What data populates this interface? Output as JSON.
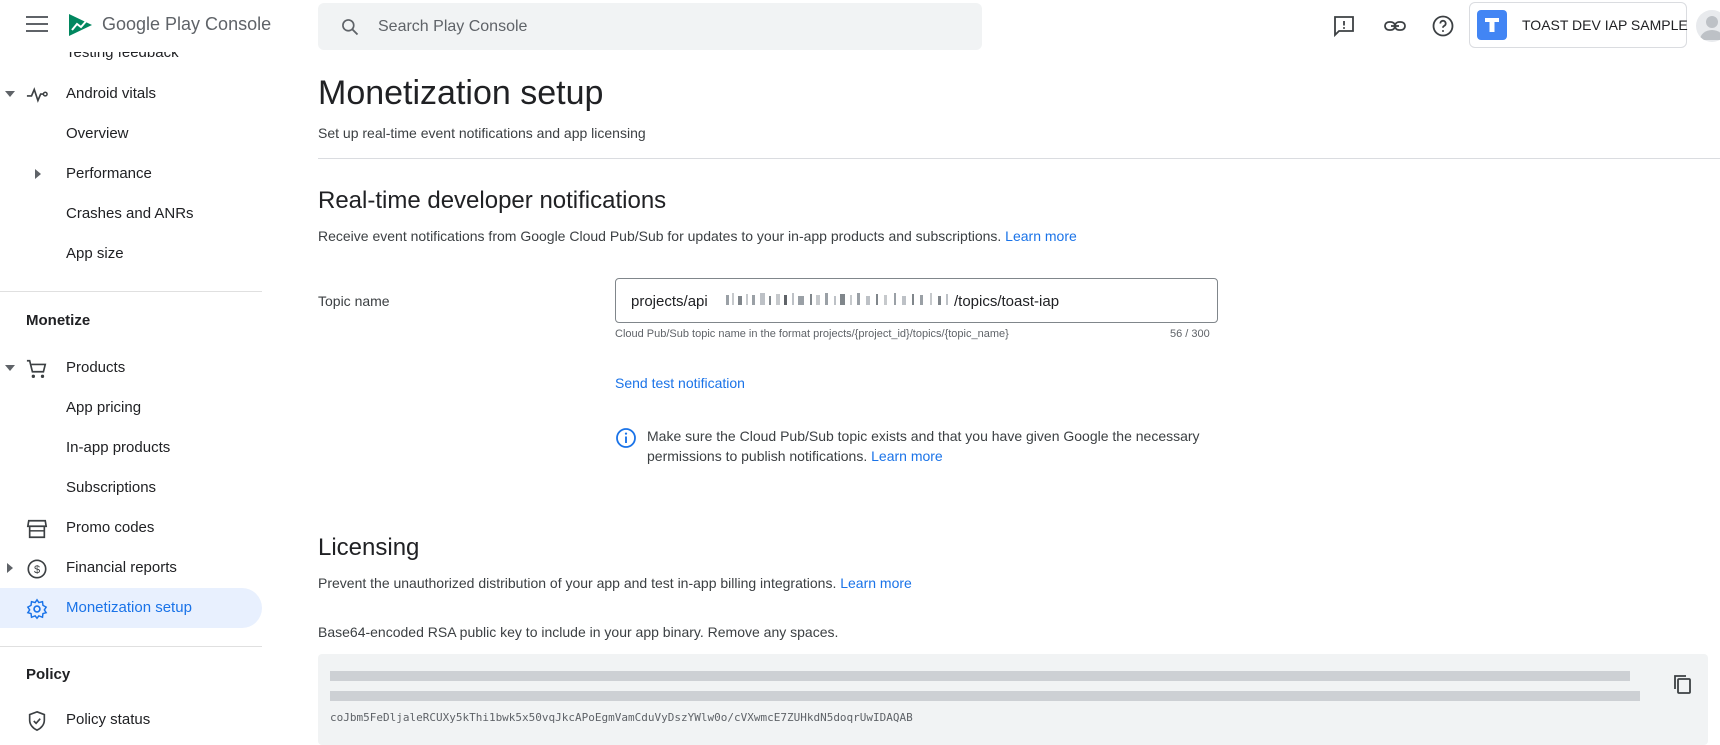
{
  "header": {
    "app_name": "Google Play Console",
    "search_placeholder": "Search Play Console",
    "app_chip_label": "TOAST DEV IAP SAMPLE",
    "icons": [
      "menu-icon",
      "play-console-logo",
      "search-icon",
      "feedback-icon",
      "link-icon",
      "help-icon",
      "app-icon",
      "avatar"
    ]
  },
  "sidebar": {
    "cut_item": "Testing feedback",
    "items": [
      {
        "label": "Android vitals",
        "icon": "vitals-icon",
        "expanded": true
      },
      {
        "label": "Overview"
      },
      {
        "label": "Performance",
        "collapsed": true
      },
      {
        "label": "Crashes and ANRs"
      },
      {
        "label": "App size"
      }
    ],
    "monetize_heading": "Monetize",
    "monetize_items": [
      {
        "label": "Products",
        "icon": "cart-icon",
        "expanded": true
      },
      {
        "label": "App pricing"
      },
      {
        "label": "In-app products"
      },
      {
        "label": "Subscriptions"
      },
      {
        "label": "Promo codes",
        "icon": "store-icon"
      },
      {
        "label": "Financial reports",
        "icon": "dollar-icon",
        "collapsed": true
      },
      {
        "label": "Monetization setup",
        "icon": "gear-icon",
        "active": true
      }
    ],
    "policy_heading": "Policy",
    "policy_items": [
      {
        "label": "Policy status",
        "icon": "shield-icon"
      }
    ]
  },
  "main": {
    "title": "Monetization setup",
    "subtitle": "Set up real-time event notifications and app licensing",
    "rtdn": {
      "heading": "Real-time developer notifications",
      "description": "Receive event notifications from Google Cloud Pub/Sub for updates to your in-app products and subscriptions.",
      "learn_more": "Learn more",
      "topic_label": "Topic name",
      "topic_prefix": "projects/api",
      "topic_suffix": "/topics/toast-iap",
      "helper_text": "Cloud Pub/Sub topic name in the format projects/{project_id}/topics/{topic_name}",
      "counter": "56 / 300",
      "send_test": "Send test notification",
      "info_text": "Make sure the Cloud Pub/Sub topic exists and that you have given Google the necessary permissions to publish notifications.",
      "info_learn_more": "Learn more"
    },
    "licensing": {
      "heading": "Licensing",
      "description": "Prevent the unauthorized distribution of your app and test in-app billing integrations.",
      "learn_more": "Learn more",
      "key_label": "Base64-encoded RSA public key to include in your app binary. Remove any spaces.",
      "key_line_3": "coJbm5FeDljaleRCUXy5kThi1bwk5x50vqJkcAPoEgmVamCduVyDszYWlw0o/cVXwmcE7ZUHkdN5doqrUwIDAQAB"
    }
  }
}
